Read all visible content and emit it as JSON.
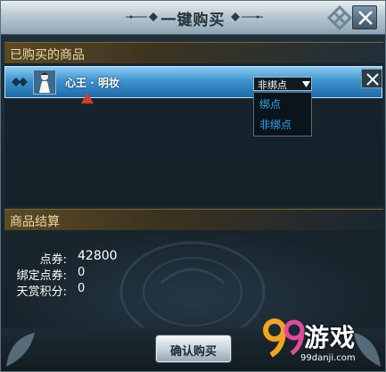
{
  "window": {
    "title": "一键购买"
  },
  "purchased": {
    "header": "已购买的商品",
    "items": [
      {
        "name": "心王 · 明妆",
        "bind_value": "非绑点"
      }
    ],
    "dropdown_options": [
      "绑点",
      "非绑点"
    ]
  },
  "settlement": {
    "header": "商品结算",
    "rows": [
      {
        "label": "点券:",
        "value": "42800"
      },
      {
        "label": "绑定点券:",
        "value": "0"
      },
      {
        "label": "天赏积分:",
        "value": "0"
      }
    ]
  },
  "actions": {
    "confirm_label": "确认购买"
  },
  "watermark": {
    "brand": "游戏",
    "url": "99danji.com"
  },
  "colors": {
    "accent": "#3e94cf",
    "dropdown_text": "#2ea8ef",
    "header_text": "#ecd9a4"
  }
}
